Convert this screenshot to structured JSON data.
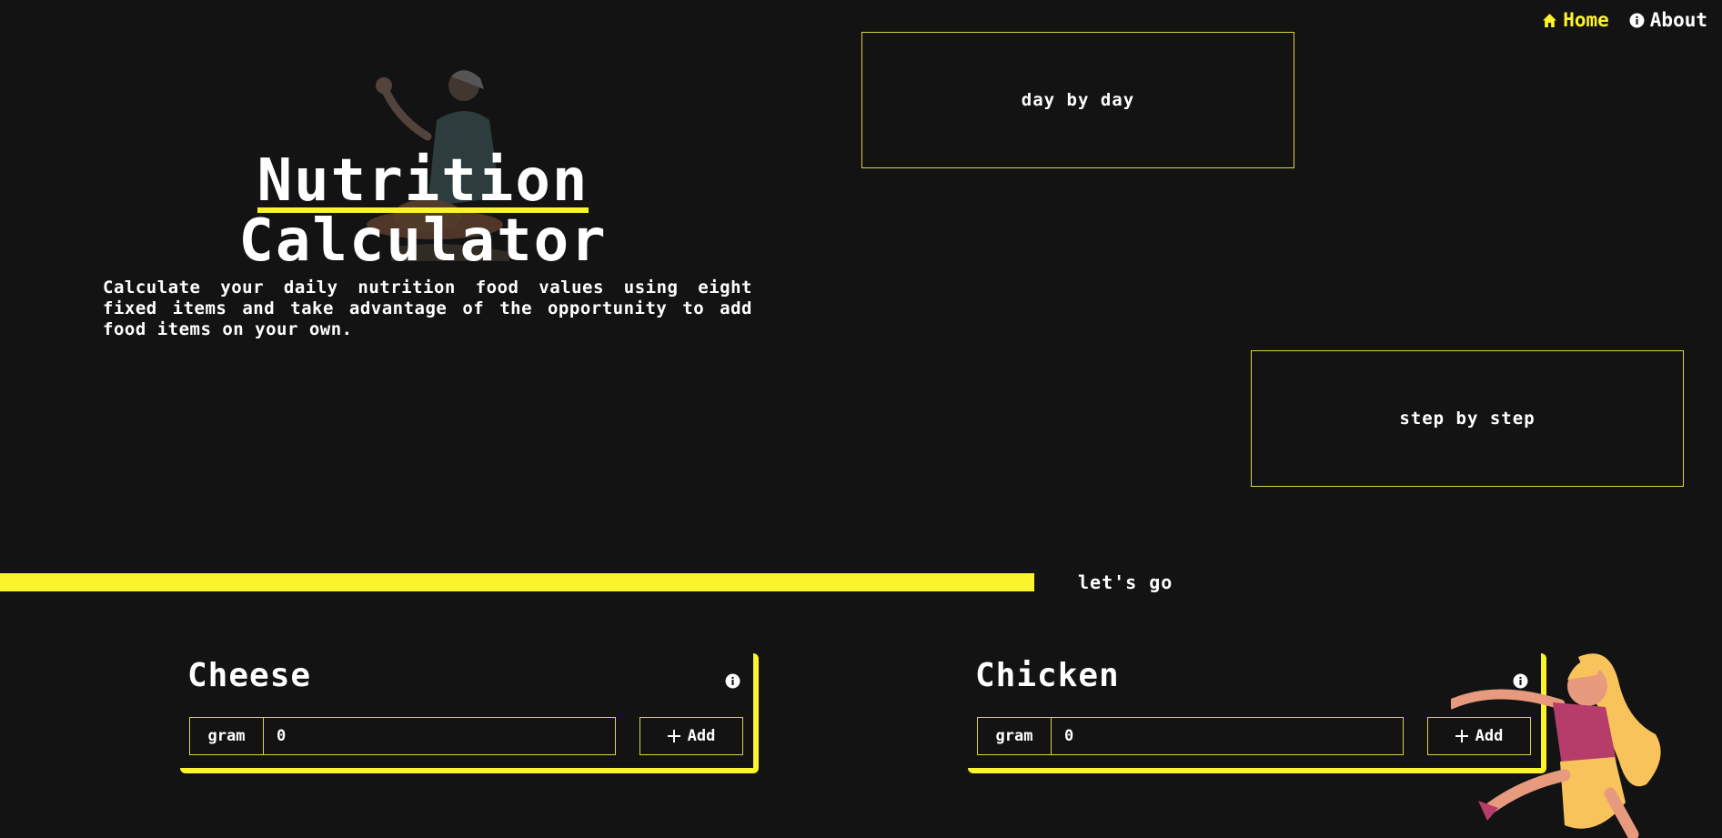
{
  "nav": [
    {
      "label": "Home",
      "icon": "home-icon",
      "active": true
    },
    {
      "label": "About",
      "icon": "info-icon",
      "active": false
    }
  ],
  "hero": {
    "title_line1": "Nutrition",
    "title_line2": "Calculator",
    "subtitle": "Calculate your daily nutrition food values using eight fixed items and take advantage of the opportunity to add food items on your own."
  },
  "features": {
    "day": "day by day",
    "step": "step by step"
  },
  "cta": "let's go",
  "foods": [
    {
      "name": "Cheese",
      "unit": "gram",
      "value": "0",
      "add_label": "Add"
    },
    {
      "name": "Chicken",
      "unit": "gram",
      "value": "0",
      "add_label": "Add"
    }
  ],
  "colors": {
    "accent": "#fbf32b",
    "background": "#131313",
    "text": "#ffffff"
  }
}
